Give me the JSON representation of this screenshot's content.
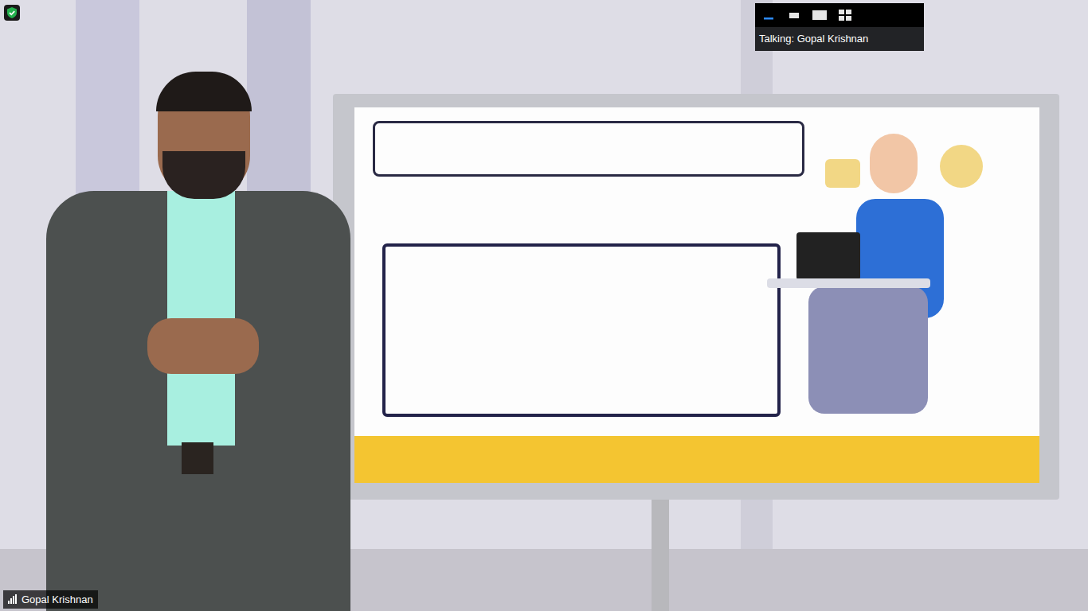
{
  "view_options": [
    {
      "kind": "minimize",
      "selected": true
    },
    {
      "kind": "small",
      "selected": false
    },
    {
      "kind": "large",
      "selected": false
    },
    {
      "kind": "grid",
      "selected": false
    }
  ],
  "active_speaker": {
    "label": "Talking: Gopal Krishnan"
  },
  "participant": {
    "name": "Gopal Krishnan"
  }
}
